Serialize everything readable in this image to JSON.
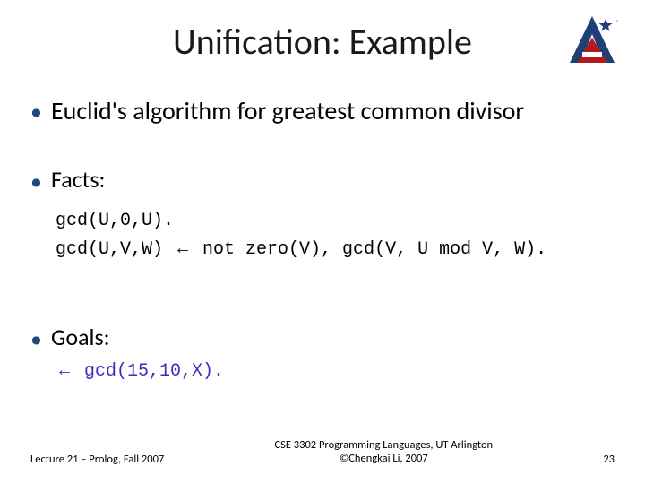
{
  "title": "Unification: Example",
  "logo": {
    "name": "uta-logo"
  },
  "bullets": {
    "intro": "Euclid's algorithm for greatest common divisor",
    "facts_label": "Facts:",
    "goals_label": "Goals:"
  },
  "code": {
    "fact1": "gcd(U,0,U).",
    "fact2_pre": "gcd(U,V,W) ",
    "arrow": "←",
    "fact2_post": " not zero(V), gcd(V, U mod V, W).",
    "goal_pre": "",
    "goal_post": " gcd(15,10,X)."
  },
  "footer": {
    "left": "Lecture 21 – Prolog, Fall 2007",
    "center_line1": "CSE 3302 Programming Languages, UT-Arlington",
    "center_line2": "©Chengkai Li, 2007",
    "page": "23"
  },
  "colors": {
    "bullet": "#1f497d",
    "goal": "#3b2fbf"
  },
  "chart_data": null
}
